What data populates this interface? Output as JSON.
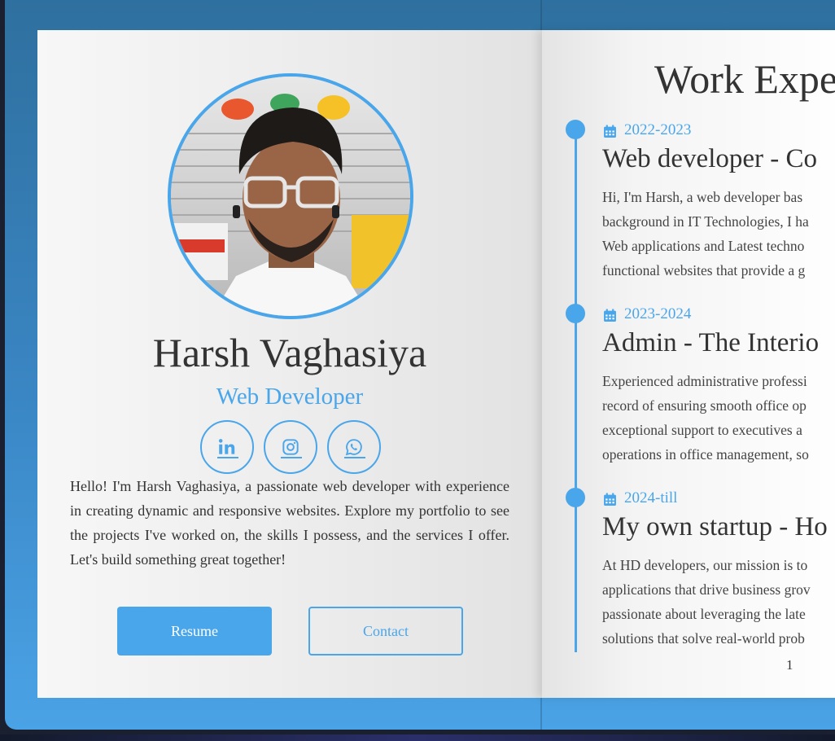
{
  "profile": {
    "name": "Harsh Vaghasiya",
    "role": "Web Developer",
    "bio": "Hello! I'm Harsh Vaghasiya, a passionate web developer with experience in creating dynamic and responsive websites. Explore my portfolio to see the projects I've worked on, the skills I possess, and the services I offer. Let's build something great together!",
    "socials": [
      {
        "icon": "linkedin-icon"
      },
      {
        "icon": "instagram-icon"
      },
      {
        "icon": "whatsapp-icon"
      }
    ],
    "resume_label": "Resume",
    "contact_label": "Contact"
  },
  "experience": {
    "title": "Work Expe",
    "entries": [
      {
        "date": "2022-2023",
        "title": "Web developer - Co",
        "desc_lines": [
          "Hi, I'm Harsh, a web developer bas",
          "background in IT Technologies, I ha",
          "Web applications and Latest techno",
          "functional websites that provide a g"
        ]
      },
      {
        "date": "2023-2024",
        "title": "Admin - The Interio",
        "desc_lines": [
          "Experienced administrative professi",
          "record of ensuring smooth office op",
          "exceptional support to executives a",
          "operations in office management, so"
        ]
      },
      {
        "date": "2024-till",
        "title": "My own startup - Ho",
        "desc_lines": [
          "At HD developers, our mission is to",
          "applications that drive business grov",
          "passionate about leveraging the late",
          "solutions that solve real-world prob"
        ]
      }
    ],
    "page_number": "1"
  },
  "colors": {
    "accent": "#4aa6ea",
    "text": "#333333",
    "frame_top": "#2e6f9d",
    "frame_bottom": "#4aa3e6"
  }
}
